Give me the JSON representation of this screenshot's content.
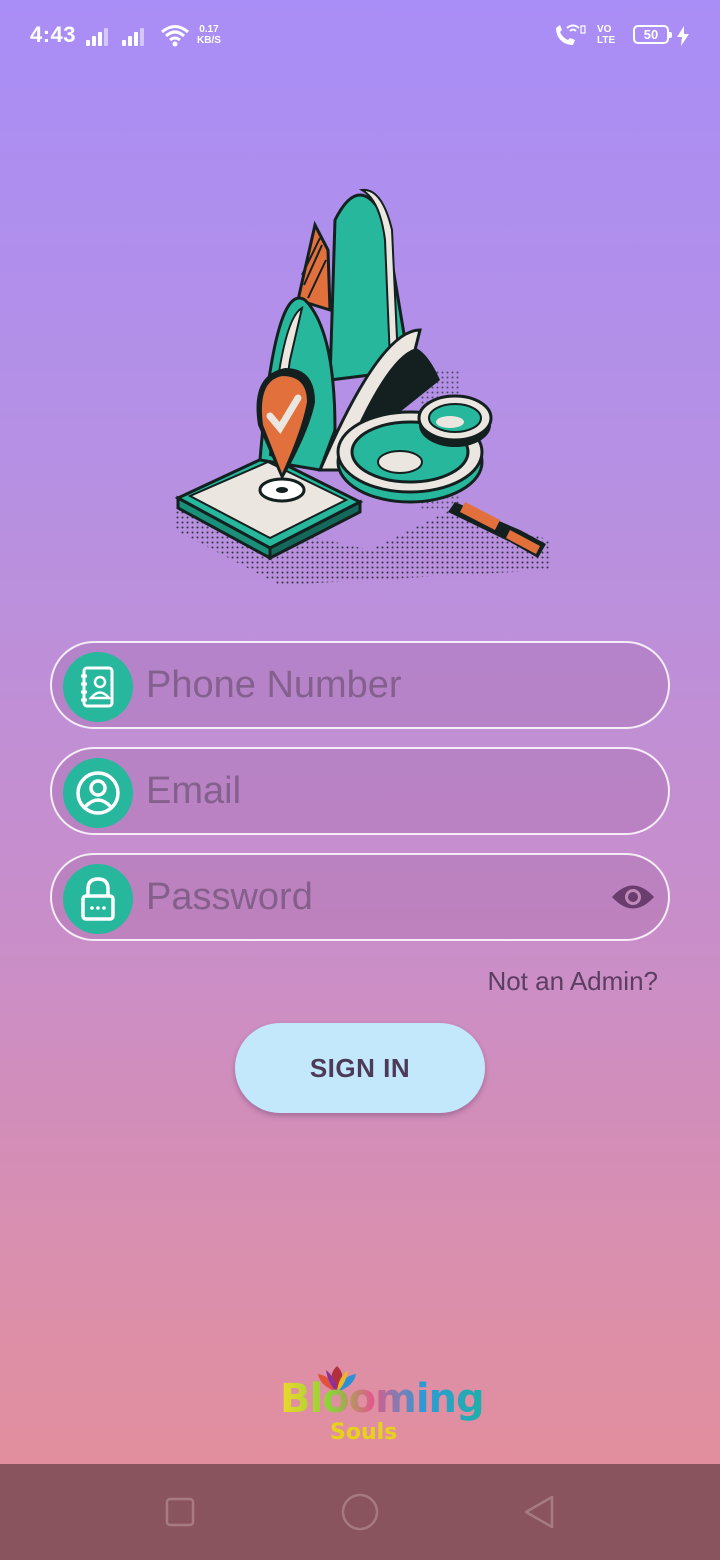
{
  "status_bar": {
    "time": "4:43",
    "net_speed_value": "0.17",
    "net_speed_unit": "KB/S",
    "volte_top": "VO",
    "volte_bottom": "LTE",
    "battery_level": "50"
  },
  "form": {
    "phone_placeholder": "Phone Number",
    "email_placeholder": "Email",
    "password_placeholder": "Password",
    "not_admin_link": "Not an Admin?",
    "signin_label": "SIGN IN"
  },
  "branding": {
    "logo_main": "Blooming",
    "logo_sub": "Souls"
  },
  "icons": {
    "phone_field": "contact-book-icon",
    "email_field": "user-circle-icon",
    "password_field": "lock-icon",
    "password_toggle": "eye-icon",
    "nav_recent": "square-icon",
    "nav_home": "circle-icon",
    "nav_back": "triangle-back-icon"
  },
  "colors": {
    "accent_teal": "#27b79c",
    "button_bg": "#c3e8fb",
    "nav_bar": "#8a545e"
  }
}
